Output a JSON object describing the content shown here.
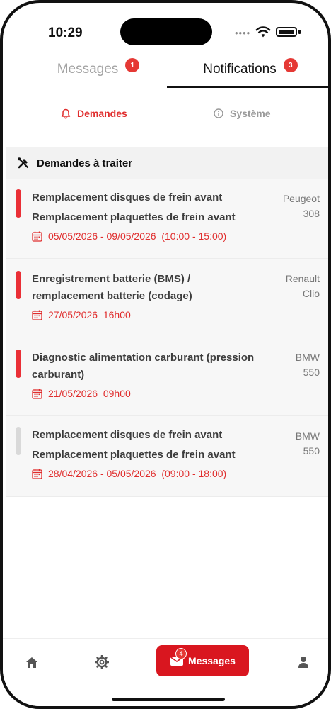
{
  "status_bar": {
    "time": "10:29"
  },
  "top_tabs": {
    "messages": {
      "label": "Messages",
      "badge": "1"
    },
    "notifications": {
      "label": "Notifications",
      "badge": "3"
    }
  },
  "sub_tabs": {
    "demandes": "Demandes",
    "systeme": "Système"
  },
  "section": {
    "title": "Demandes à traiter"
  },
  "requests": [
    {
      "lines": [
        "Remplacement disques de frein avant",
        "Remplacement plaquettes de frein avant"
      ],
      "date": "05/05/2026 - 09/05/2026  (10:00 - 15:00)",
      "make": "Peugeot",
      "model": "308",
      "status": "urgent"
    },
    {
      "lines": [
        "Enregistrement batterie (BMS) /",
        "remplacement batterie (codage)"
      ],
      "date": "27/05/2026  16h00",
      "make": "Renault",
      "model": "Clio",
      "status": "urgent"
    },
    {
      "lines": [
        "Diagnostic alimentation carburant (pression",
        "carburant)"
      ],
      "date": "21/05/2026  09h00",
      "make": "BMW",
      "model": "550",
      "status": "urgent"
    },
    {
      "lines": [
        "Remplacement disques de frein avant",
        "Remplacement plaquettes de frein avant"
      ],
      "date": "28/04/2026 - 05/05/2026  (09:00 - 18:00)",
      "make": "BMW",
      "model": "550",
      "status": "past"
    }
  ],
  "bottom_nav": {
    "messages_label": "Messages",
    "messages_badge": "4",
    "icons": [
      "home-icon",
      "settings-icon",
      "mail-icon",
      "profile-icon"
    ]
  },
  "colors": {
    "accent": "#e02d2d",
    "nav_active": "#d9161f",
    "status_bar_inactive": "#d9d9d9"
  }
}
